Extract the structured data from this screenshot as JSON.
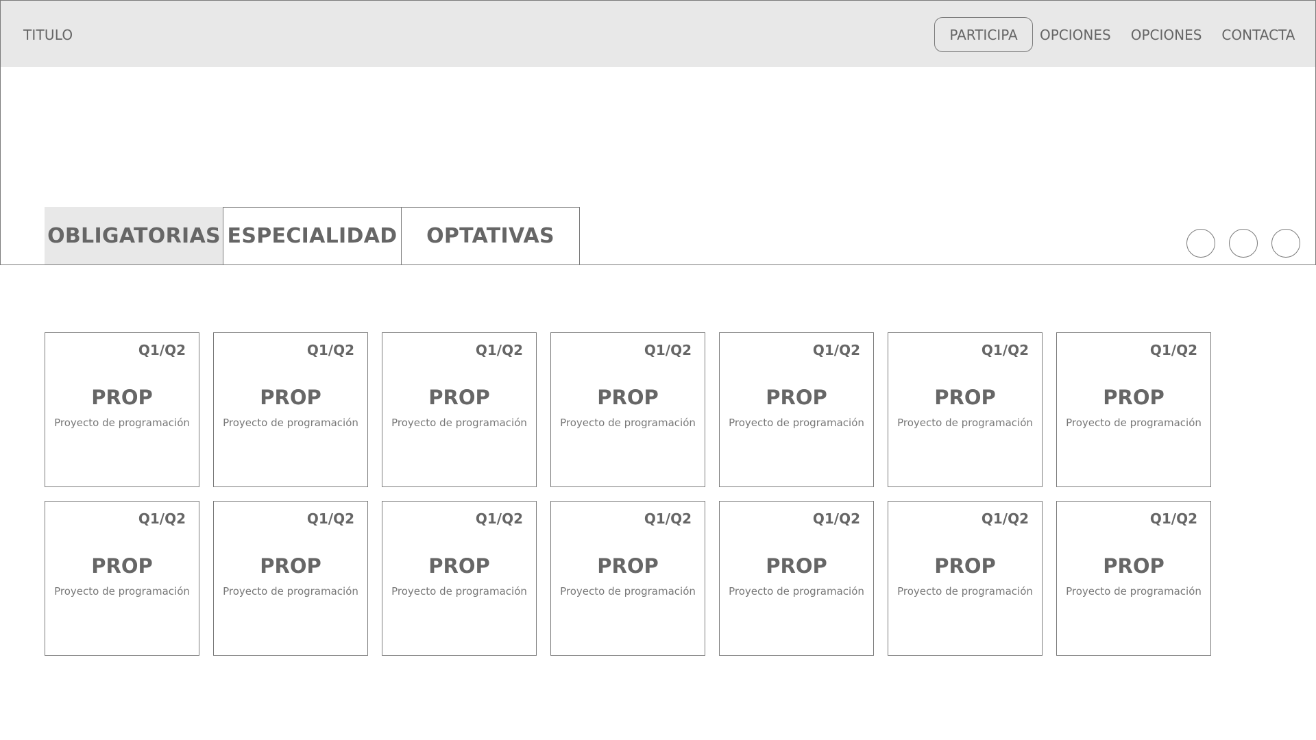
{
  "header": {
    "title": "TITULO",
    "nav": [
      {
        "label": "PARTICIPA",
        "active": true
      },
      {
        "label": "OPCIONES",
        "active": false
      },
      {
        "label": "OPCIONES",
        "active": false
      },
      {
        "label": "CONTACTA",
        "active": false
      }
    ]
  },
  "tabs": [
    {
      "label": "OBLIGATORIAS",
      "active": true
    },
    {
      "label": "ESPECIALIDAD",
      "active": false
    },
    {
      "label": "OPTATIVAS",
      "active": false
    }
  ],
  "carousel": {
    "dot_count": 3
  },
  "cards": [
    {
      "term": "Q1/Q2",
      "code": "PROP",
      "name": "Proyecto de programación"
    },
    {
      "term": "Q1/Q2",
      "code": "PROP",
      "name": "Proyecto de programación"
    },
    {
      "term": "Q1/Q2",
      "code": "PROP",
      "name": "Proyecto de programación"
    },
    {
      "term": "Q1/Q2",
      "code": "PROP",
      "name": "Proyecto de programación"
    },
    {
      "term": "Q1/Q2",
      "code": "PROP",
      "name": "Proyecto de programación"
    },
    {
      "term": "Q1/Q2",
      "code": "PROP",
      "name": "Proyecto de programación"
    },
    {
      "term": "Q1/Q2",
      "code": "PROP",
      "name": "Proyecto de programación"
    },
    {
      "term": "Q1/Q2",
      "code": "PROP",
      "name": "Proyecto de programación"
    },
    {
      "term": "Q1/Q2",
      "code": "PROP",
      "name": "Proyecto de programación"
    },
    {
      "term": "Q1/Q2",
      "code": "PROP",
      "name": "Proyecto de programación"
    },
    {
      "term": "Q1/Q2",
      "code": "PROP",
      "name": "Proyecto de programación"
    },
    {
      "term": "Q1/Q2",
      "code": "PROP",
      "name": "Proyecto de programación"
    },
    {
      "term": "Q1/Q2",
      "code": "PROP",
      "name": "Proyecto de programación"
    },
    {
      "term": "Q1/Q2",
      "code": "PROP",
      "name": "Proyecto de programación"
    }
  ],
  "colors": {
    "header_bg": "#e8e8e8",
    "border": "#7a7a7a",
    "text": "#666666"
  }
}
